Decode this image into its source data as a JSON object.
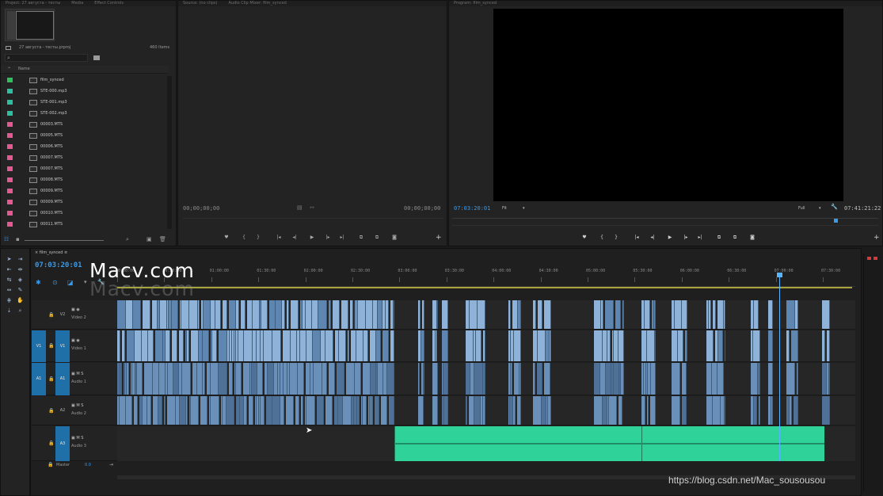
{
  "watermark": {
    "main": "Macv.com",
    "shadow": "Macv.com",
    "url": "https://blog.csdn.net/Mac_sousousou"
  },
  "project_panel": {
    "project_file": "27 августа - тесты.prproj",
    "item_count": "460 Items",
    "column_name": "Name",
    "items": [
      {
        "name": "film_synced",
        "label_color": "#2fbf60",
        "icon": "sequence-icon"
      },
      {
        "name": "STE-000.mp3",
        "label_color": "#2fbfa0",
        "icon": "audio-file-icon"
      },
      {
        "name": "STE-001.mp3",
        "label_color": "#2fbfa0",
        "icon": "audio-file-icon"
      },
      {
        "name": "STE-002.mp3",
        "label_color": "#2fbfa0",
        "icon": "audio-file-icon"
      },
      {
        "name": "00003.MTS",
        "label_color": "#e25a8f",
        "icon": "video-file-icon"
      },
      {
        "name": "00005.MTS",
        "label_color": "#e25a8f",
        "icon": "video-file-icon"
      },
      {
        "name": "00006.MTS",
        "label_color": "#e25a8f",
        "icon": "video-file-icon"
      },
      {
        "name": "00007.MTS",
        "label_color": "#e25a8f",
        "icon": "video-file-icon"
      },
      {
        "name": "00007.MTS",
        "label_color": "#e25a8f",
        "icon": "video-file-icon"
      },
      {
        "name": "00008.MTS",
        "label_color": "#e25a8f",
        "icon": "video-file-icon"
      },
      {
        "name": "00009.MTS",
        "label_color": "#e25a8f",
        "icon": "video-file-icon"
      },
      {
        "name": "00009.MTS",
        "label_color": "#e25a8f",
        "icon": "video-file-icon"
      },
      {
        "name": "00010.MTS",
        "label_color": "#e25a8f",
        "icon": "video-file-icon"
      },
      {
        "name": "00011.MTS",
        "label_color": "#e25a8f",
        "icon": "video-file-icon"
      }
    ]
  },
  "source_monitor": {
    "timecode_left": "00;00;00;00",
    "timecode_right": "00;00;00;00"
  },
  "program_monitor": {
    "timecode": "07:03:20:01",
    "fit": "Fit",
    "quality": "Full",
    "duration": "07:41:21:22"
  },
  "transport": [
    "♥",
    "{",
    "}",
    "|◂",
    "◂|",
    "▶",
    "|▸",
    "▸|",
    "⧉",
    "⧉",
    "◙"
  ],
  "timeline": {
    "sequence_name": "film_synced",
    "timecode": "07:03:20:01",
    "ruler": [
      "00:00:00",
      "00:30:00",
      "01:00:00",
      "01:30:00",
      "02:00:00",
      "02:30:00",
      "03:00:00",
      "03:30:00",
      "04:00:00",
      "04:30:00",
      "05:00:00",
      "05:30:00",
      "06:00:00",
      "06:30:00",
      "07:00:00",
      "07:30:00"
    ],
    "tracks": [
      {
        "tag": "V2",
        "name": "Video 2",
        "source": ""
      },
      {
        "tag": "V1",
        "name": "Video 1",
        "source": "V1"
      },
      {
        "tag": "A1",
        "name": "Audio 1",
        "source": "A1"
      },
      {
        "tag": "A2",
        "name": "Audio 2",
        "source": ""
      },
      {
        "tag": "A3",
        "name": "Audio 3",
        "source": ""
      }
    ],
    "track_controls": {
      "mute": "M",
      "solo": "S"
    },
    "master": {
      "label": "Master",
      "value": "0.0"
    },
    "colors": {
      "video_clip": "#8fb2d8",
      "audio_clip": "#6a8fb8",
      "audio_green": "#2fd39a",
      "playhead": "#58b4ff",
      "target": "#1f6fa8"
    }
  }
}
